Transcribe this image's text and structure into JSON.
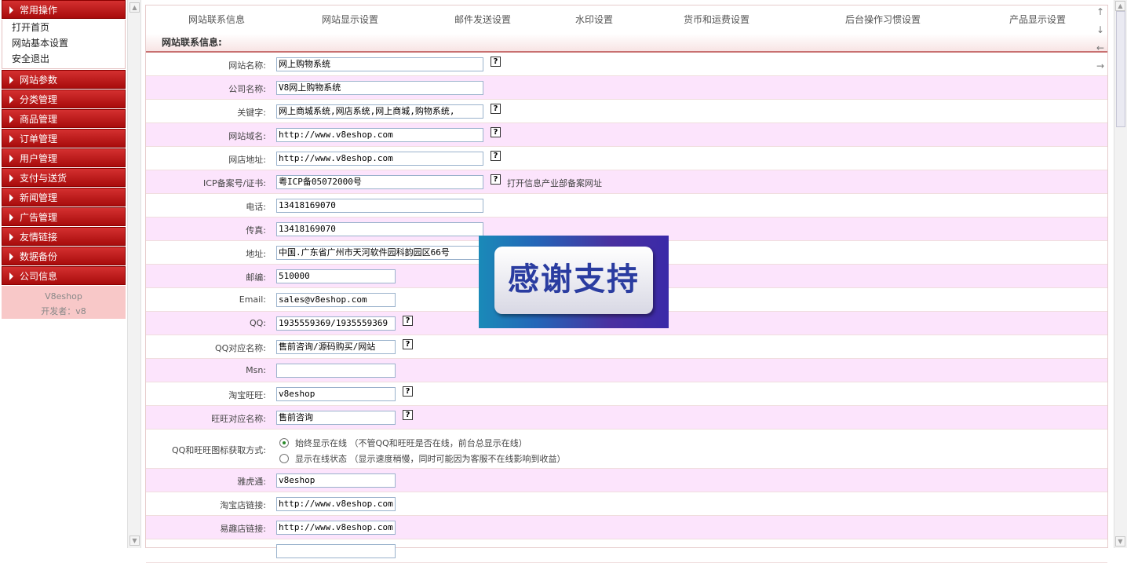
{
  "sidebar": {
    "common_ops": "常用操作",
    "sub_items": [
      "打开首页",
      "网站基本设置",
      "安全退出"
    ],
    "menus": [
      "网站参数",
      "分类管理",
      "商品管理",
      "订单管理",
      "用户管理",
      "支付与送货",
      "新闻管理",
      "广告管理",
      "友情链接",
      "数据备份",
      "公司信息"
    ],
    "footer_brand": "V8eshop",
    "footer_dev": "开发者：v8"
  },
  "tabs": [
    "网站联系信息",
    "网站显示设置",
    "邮件发送设置",
    "水印设置",
    "货币和运费设置",
    "后台操作习惯设置",
    "产品显示设置"
  ],
  "right_nav": [
    "↑",
    "↓",
    "←",
    "→"
  ],
  "section_title": "网站联系信息:",
  "form": {
    "site_name_label": "网站名称:",
    "site_name": "网上购物系统",
    "company_label": "公司名称:",
    "company": "V8网上购物系统",
    "keywords_label": "关键字:",
    "keywords": "网上商城系统,网店系统,网上商城,购物系统,",
    "domain_label": "网站域名:",
    "domain": "http://www.v8eshop.com",
    "store_label": "网店地址:",
    "store": "http://www.v8eshop.com",
    "icp_label": "ICP备案号/证书:",
    "icp": "粤ICP备05072000号",
    "icp_link": "打开信息产业部备案网址",
    "phone_label": "电话:",
    "phone": "13418169070",
    "fax_label": "传真:",
    "fax": "13418169070",
    "address_label": "地址:",
    "address": "中国.广东省广州市天河软件园科韵园区66号",
    "zip_label": "邮编:",
    "zip": "510000",
    "email_label": "Email:",
    "email": "sales@v8eshop.com",
    "qq_label": "QQ:",
    "qq": "1935559369/1935559369",
    "qq_name_label": "QQ对应名称:",
    "qq_name": "售前咨询/源码购买/网站",
    "msn_label": "Msn:",
    "msn": "",
    "taobao_ww_label": "淘宝旺旺:",
    "taobao_ww": "v8eshop",
    "ww_name_label": "旺旺对应名称:",
    "ww_name": "售前咨询",
    "icon_mode_label": "QQ和旺旺图标获取方式:",
    "icon_mode_opt1": "始终显示在线 （不管QQ和旺旺是否在线，前台总显示在线）",
    "icon_mode_opt2": "显示在线状态 （显示速度稍慢，同时可能因为客服不在线影响到收益）",
    "yahoo_label": "雅虎通:",
    "yahoo": "v8eshop",
    "taobao_link_label": "淘宝店链接:",
    "taobao_link": "http://www.v8eshop.com",
    "yiqu_link_label": "易趣店链接:",
    "yiqu_link": "http://www.v8eshop.com",
    "help_glyph": "?"
  },
  "banner_text": "感谢支持"
}
